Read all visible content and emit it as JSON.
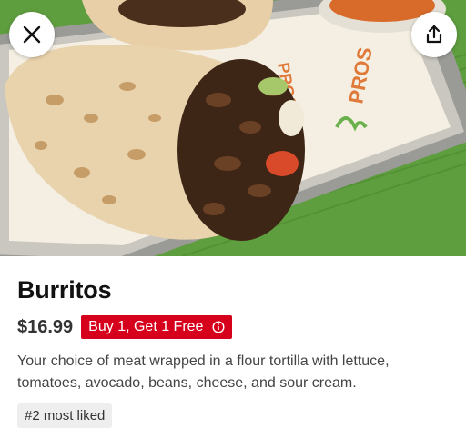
{
  "item": {
    "title": "Burritos",
    "price": "$16.99",
    "promo_label": "Buy 1, Get 1 Free",
    "description": "Your choice of meat wrapped in a flour tortilla with lettuce, tomatoes, avocado, beans, cheese, and sour cream.",
    "rank_badge": "#2 most liked"
  },
  "hero": {
    "paper_text": "PROS"
  },
  "icons": {
    "close": "close-icon",
    "share": "share-icon",
    "info": "info-icon"
  },
  "colors": {
    "promo_background": "#d6001c",
    "badge_background": "#eeeeee"
  }
}
